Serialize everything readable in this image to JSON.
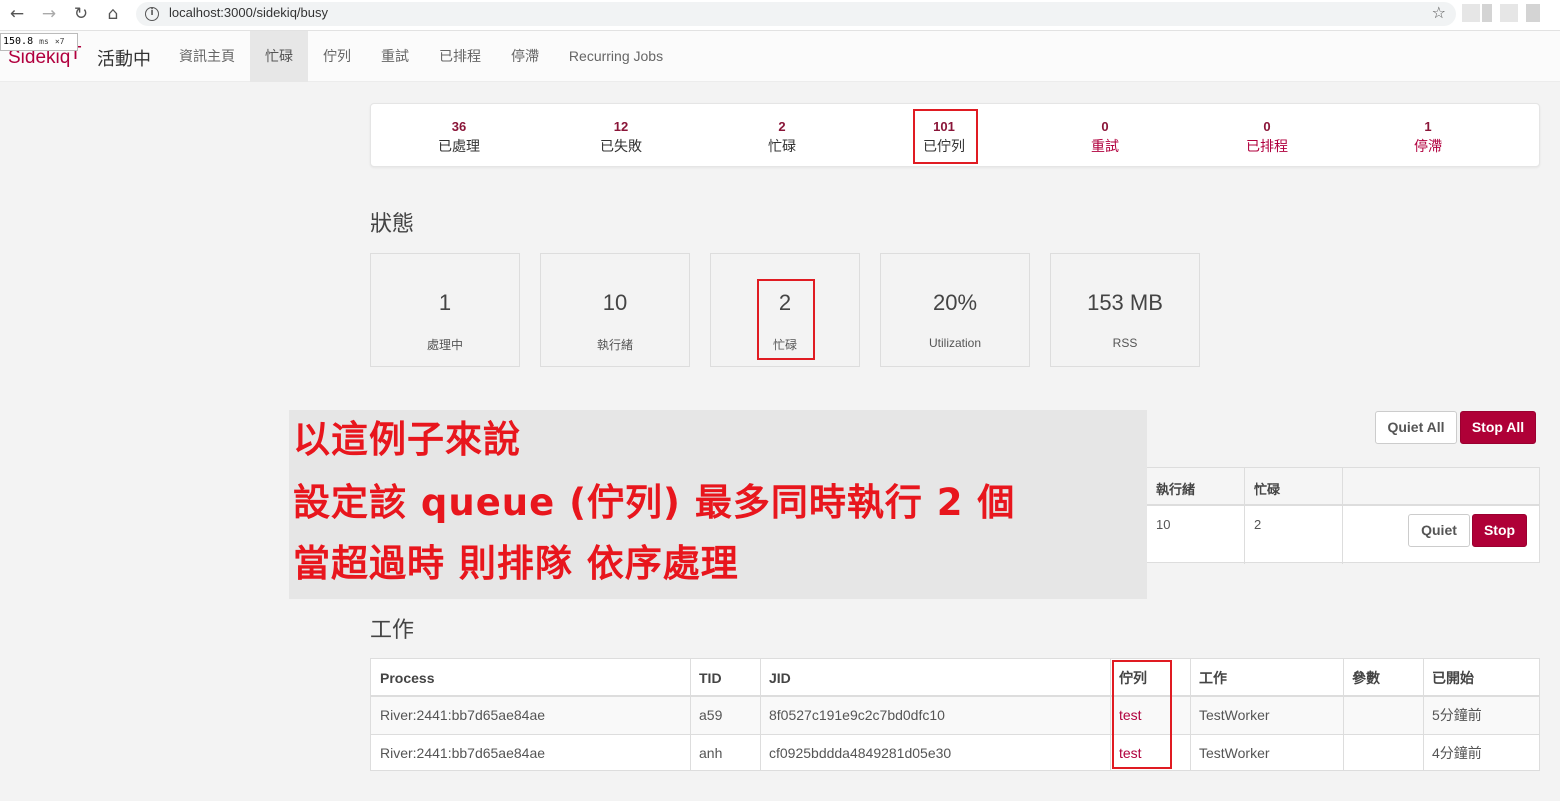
{
  "browser": {
    "url": "localhost:3000/sidekiq/busy",
    "timer_value": "150.8",
    "timer_unit": "ms",
    "timer_count": "×7"
  },
  "navbar": {
    "brand": "Sidekiq",
    "status": "活動中",
    "items": [
      {
        "label": "資訊主頁",
        "active": false
      },
      {
        "label": "忙碌",
        "active": true
      },
      {
        "label": "佇列",
        "active": false
      },
      {
        "label": "重試",
        "active": false
      },
      {
        "label": "已排程",
        "active": false
      },
      {
        "label": "停滯",
        "active": false
      },
      {
        "label": "Recurring Jobs",
        "active": false
      }
    ]
  },
  "summary": [
    {
      "count": "36",
      "label": "已處理"
    },
    {
      "count": "12",
      "label": "已失敗"
    },
    {
      "count": "2",
      "label": "忙碌"
    },
    {
      "count": "101",
      "label": "已佇列"
    },
    {
      "count": "0",
      "label": "重試"
    },
    {
      "count": "0",
      "label": "已排程"
    },
    {
      "count": "1",
      "label": "停滯"
    }
  ],
  "status": {
    "title": "狀態",
    "boxes": [
      {
        "value": "1",
        "label": "處理中"
      },
      {
        "value": "10",
        "label": "執行緒"
      },
      {
        "value": "2",
        "label": "忙碌"
      },
      {
        "value": "20%",
        "label": "Utilization"
      },
      {
        "value": "153 MB",
        "label": "RSS"
      }
    ]
  },
  "process_controls": {
    "quiet_all": "Quiet All",
    "stop_all": "Stop All"
  },
  "process_table": {
    "headers": [
      "執行緒",
      "忙碌"
    ],
    "row": {
      "threads": "10",
      "busy": "2",
      "quiet": "Quiet",
      "stop": "Stop"
    }
  },
  "jobs": {
    "title": "工作",
    "headers": [
      "Process",
      "TID",
      "JID",
      "佇列",
      "工作",
      "參數",
      "已開始"
    ],
    "rows": [
      {
        "process": "River:2441:bb7d65ae84ae",
        "tid": "a59",
        "jid": "8f0527c191e9c2c7bd0dfc10",
        "queue": "test",
        "job": "TestWorker",
        "args": "",
        "started": "5分鐘前"
      },
      {
        "process": "River:2441:bb7d65ae84ae",
        "tid": "anh",
        "jid": "cf0925bddda4849281d05e30",
        "queue": "test",
        "job": "TestWorker",
        "args": "",
        "started": "4分鐘前"
      }
    ]
  },
  "annotation": {
    "lines": [
      "以這例子來說",
      "設定該 queue (佇列) 最多同時執行 2 個",
      "當超過時 則排隊 依序處理"
    ],
    "color": "#e8161d"
  },
  "colors": {
    "brand": "#b1003e",
    "danger_button": "#af0037"
  }
}
